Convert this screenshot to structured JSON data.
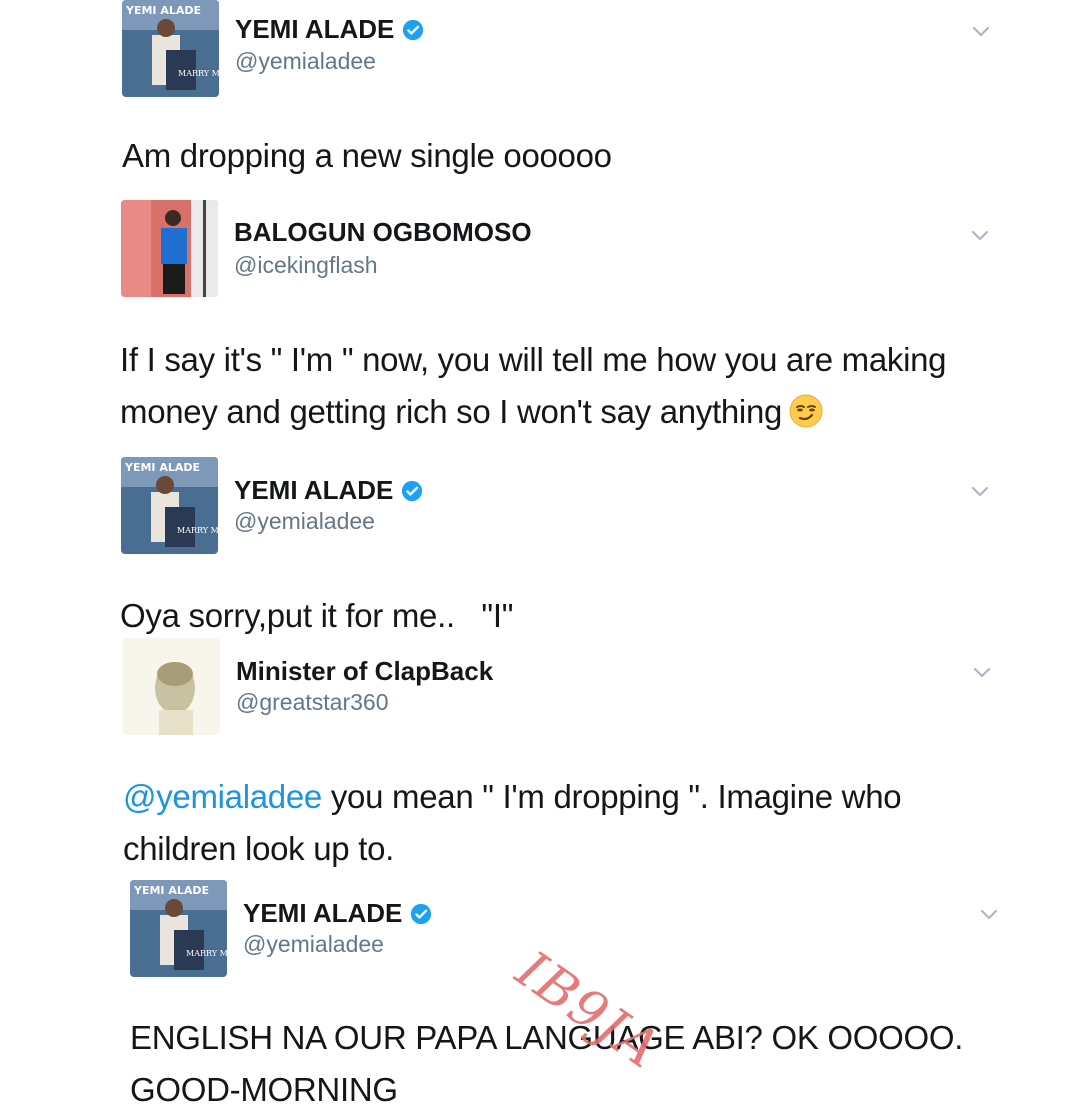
{
  "tweets": [
    {
      "name": "YEMI ALADE",
      "handle": "@yemialadee",
      "verified": true,
      "text": "Am dropping a new single oooooo"
    },
    {
      "name": "BALOGUN OGBOMOSO",
      "handle": "@icekingflash",
      "verified": false,
      "text_line1": "If I say it's \" I'm \" now, you will tell me how you are making",
      "text_line2": "money and getting rich so I won't say anything",
      "emoji": "smirking-face-emoji"
    },
    {
      "name": "YEMI ALADE",
      "handle": "@yemialadee",
      "verified": true,
      "text": "Oya sorry,put it for me..   \"I\""
    },
    {
      "name": "Minister of ClapBack",
      "handle": "@greatstar360",
      "verified": false,
      "mention": "@yemialadee",
      "text_line1_rest": " you mean \" I'm dropping \". Imagine who",
      "text_line2": "children look up to."
    },
    {
      "name": "YEMI ALADE",
      "handle": "@yemialadee",
      "verified": true,
      "text_line1": "ENGLISH NA OUR PAPA LANGUAGE ABI? OK OOOOO.",
      "text_line2": "GOOD-MORNING"
    }
  ],
  "album_art_text": {
    "logo": "YEMI ALADE",
    "title": "MARRY ME"
  },
  "watermark": "IB9JA",
  "colors": {
    "verified": "#1da1f2",
    "mention": "#1b95e0",
    "handle": "#657786",
    "watermark": "#e46d6d"
  }
}
